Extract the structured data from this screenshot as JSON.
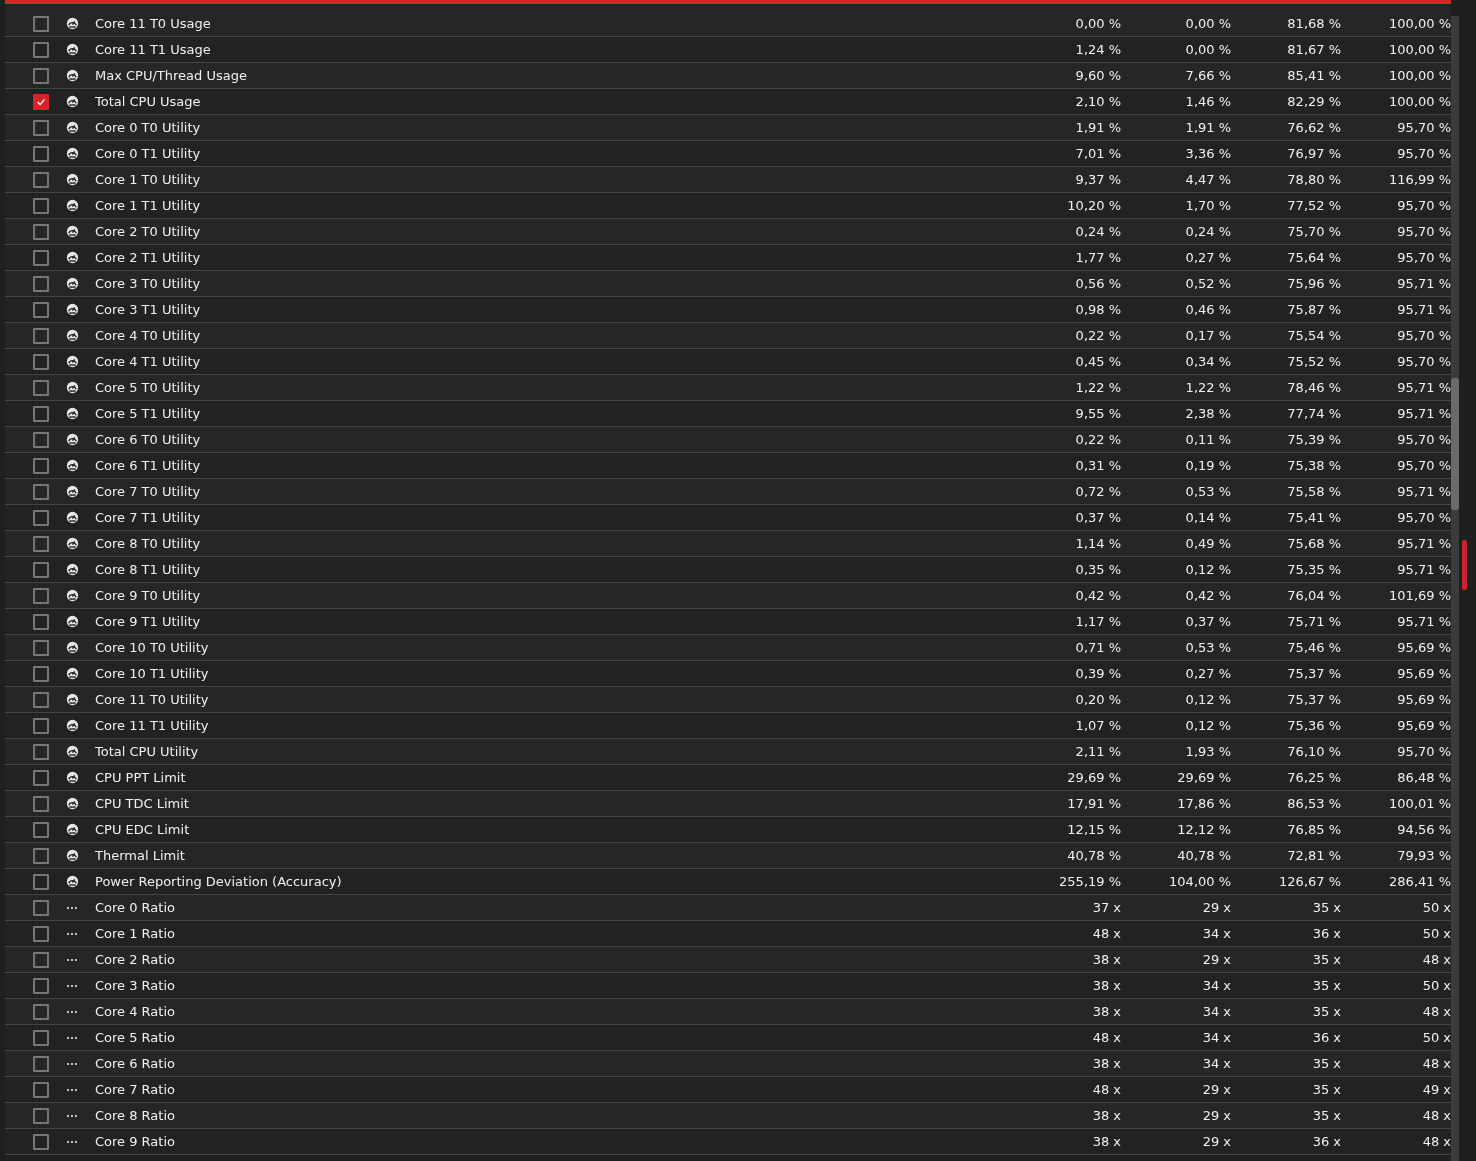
{
  "rows": [
    {
      "kind": "gauge",
      "checked": false,
      "label": "Core 11 T0 Usage",
      "values": [
        "0,00 %",
        "0,00 %",
        "81,68 %",
        "100,00 %"
      ]
    },
    {
      "kind": "gauge",
      "checked": false,
      "label": "Core 11 T1 Usage",
      "values": [
        "1,24 %",
        "0,00 %",
        "81,67 %",
        "100,00 %"
      ]
    },
    {
      "kind": "gauge",
      "checked": false,
      "label": "Max CPU/Thread Usage",
      "values": [
        "9,60 %",
        "7,66 %",
        "85,41 %",
        "100,00 %"
      ]
    },
    {
      "kind": "gauge",
      "checked": true,
      "label": "Total CPU Usage",
      "values": [
        "2,10 %",
        "1,46 %",
        "82,29 %",
        "100,00 %"
      ]
    },
    {
      "kind": "gauge",
      "checked": false,
      "label": "Core 0 T0 Utility",
      "values": [
        "1,91 %",
        "1,91 %",
        "76,62 %",
        "95,70 %"
      ]
    },
    {
      "kind": "gauge",
      "checked": false,
      "label": "Core 0 T1 Utility",
      "values": [
        "7,01 %",
        "3,36 %",
        "76,97 %",
        "95,70 %"
      ]
    },
    {
      "kind": "gauge",
      "checked": false,
      "label": "Core 1 T0 Utility",
      "values": [
        "9,37 %",
        "4,47 %",
        "78,80 %",
        "116,99 %"
      ]
    },
    {
      "kind": "gauge",
      "checked": false,
      "label": "Core 1 T1 Utility",
      "values": [
        "10,20 %",
        "1,70 %",
        "77,52 %",
        "95,70 %"
      ]
    },
    {
      "kind": "gauge",
      "checked": false,
      "label": "Core 2 T0 Utility",
      "values": [
        "0,24 %",
        "0,24 %",
        "75,70 %",
        "95,70 %"
      ]
    },
    {
      "kind": "gauge",
      "checked": false,
      "label": "Core 2 T1 Utility",
      "values": [
        "1,77 %",
        "0,27 %",
        "75,64 %",
        "95,70 %"
      ]
    },
    {
      "kind": "gauge",
      "checked": false,
      "label": "Core 3 T0 Utility",
      "values": [
        "0,56 %",
        "0,52 %",
        "75,96 %",
        "95,71 %"
      ]
    },
    {
      "kind": "gauge",
      "checked": false,
      "label": "Core 3 T1 Utility",
      "values": [
        "0,98 %",
        "0,46 %",
        "75,87 %",
        "95,71 %"
      ]
    },
    {
      "kind": "gauge",
      "checked": false,
      "label": "Core 4 T0 Utility",
      "values": [
        "0,22 %",
        "0,17 %",
        "75,54 %",
        "95,70 %"
      ]
    },
    {
      "kind": "gauge",
      "checked": false,
      "label": "Core 4 T1 Utility",
      "values": [
        "0,45 %",
        "0,34 %",
        "75,52 %",
        "95,70 %"
      ]
    },
    {
      "kind": "gauge",
      "checked": false,
      "label": "Core 5 T0 Utility",
      "values": [
        "1,22 %",
        "1,22 %",
        "78,46 %",
        "95,71 %"
      ]
    },
    {
      "kind": "gauge",
      "checked": false,
      "label": "Core 5 T1 Utility",
      "values": [
        "9,55 %",
        "2,38 %",
        "77,74 %",
        "95,71 %"
      ]
    },
    {
      "kind": "gauge",
      "checked": false,
      "label": "Core 6 T0 Utility",
      "values": [
        "0,22 %",
        "0,11 %",
        "75,39 %",
        "95,70 %"
      ]
    },
    {
      "kind": "gauge",
      "checked": false,
      "label": "Core 6 T1 Utility",
      "values": [
        "0,31 %",
        "0,19 %",
        "75,38 %",
        "95,70 %"
      ]
    },
    {
      "kind": "gauge",
      "checked": false,
      "label": "Core 7 T0 Utility",
      "values": [
        "0,72 %",
        "0,53 %",
        "75,58 %",
        "95,71 %"
      ]
    },
    {
      "kind": "gauge",
      "checked": false,
      "label": "Core 7 T1 Utility",
      "values": [
        "0,37 %",
        "0,14 %",
        "75,41 %",
        "95,70 %"
      ]
    },
    {
      "kind": "gauge",
      "checked": false,
      "label": "Core 8 T0 Utility",
      "values": [
        "1,14 %",
        "0,49 %",
        "75,68 %",
        "95,71 %"
      ]
    },
    {
      "kind": "gauge",
      "checked": false,
      "label": "Core 8 T1 Utility",
      "values": [
        "0,35 %",
        "0,12 %",
        "75,35 %",
        "95,71 %"
      ]
    },
    {
      "kind": "gauge",
      "checked": false,
      "label": "Core 9 T0 Utility",
      "values": [
        "0,42 %",
        "0,42 %",
        "76,04 %",
        "101,69 %"
      ]
    },
    {
      "kind": "gauge",
      "checked": false,
      "label": "Core 9 T1 Utility",
      "values": [
        "1,17 %",
        "0,37 %",
        "75,71 %",
        "95,71 %"
      ]
    },
    {
      "kind": "gauge",
      "checked": false,
      "label": "Core 10 T0 Utility",
      "values": [
        "0,71 %",
        "0,53 %",
        "75,46 %",
        "95,69 %"
      ]
    },
    {
      "kind": "gauge",
      "checked": false,
      "label": "Core 10 T1 Utility",
      "values": [
        "0,39 %",
        "0,27 %",
        "75,37 %",
        "95,69 %"
      ]
    },
    {
      "kind": "gauge",
      "checked": false,
      "label": "Core 11 T0 Utility",
      "values": [
        "0,20 %",
        "0,12 %",
        "75,37 %",
        "95,69 %"
      ]
    },
    {
      "kind": "gauge",
      "checked": false,
      "label": "Core 11 T1 Utility",
      "values": [
        "1,07 %",
        "0,12 %",
        "75,36 %",
        "95,69 %"
      ]
    },
    {
      "kind": "gauge",
      "checked": false,
      "label": "Total CPU Utility",
      "values": [
        "2,11 %",
        "1,93 %",
        "76,10 %",
        "95,70 %"
      ]
    },
    {
      "kind": "gauge",
      "checked": false,
      "label": "CPU PPT Limit",
      "values": [
        "29,69 %",
        "29,69 %",
        "76,25 %",
        "86,48 %"
      ]
    },
    {
      "kind": "gauge",
      "checked": false,
      "label": "CPU TDC Limit",
      "values": [
        "17,91 %",
        "17,86 %",
        "86,53 %",
        "100,01 %"
      ]
    },
    {
      "kind": "gauge",
      "checked": false,
      "label": "CPU EDC Limit",
      "values": [
        "12,15 %",
        "12,12 %",
        "76,85 %",
        "94,56 %"
      ]
    },
    {
      "kind": "gauge",
      "checked": false,
      "label": "Thermal Limit",
      "values": [
        "40,78 %",
        "40,78 %",
        "72,81 %",
        "79,93 %"
      ]
    },
    {
      "kind": "gauge",
      "checked": false,
      "label": "Power Reporting Deviation (Accuracy)",
      "values": [
        "255,19 %",
        "104,00 %",
        "126,67 %",
        "286,41 %"
      ]
    },
    {
      "kind": "dots",
      "checked": false,
      "label": "Core 0 Ratio",
      "values": [
        "37 x",
        "29 x",
        "35 x",
        "50 x"
      ]
    },
    {
      "kind": "dots",
      "checked": false,
      "label": "Core 1 Ratio",
      "values": [
        "48 x",
        "34 x",
        "36 x",
        "50 x"
      ]
    },
    {
      "kind": "dots",
      "checked": false,
      "label": "Core 2 Ratio",
      "values": [
        "38 x",
        "29 x",
        "35 x",
        "48 x"
      ]
    },
    {
      "kind": "dots",
      "checked": false,
      "label": "Core 3 Ratio",
      "values": [
        "38 x",
        "34 x",
        "35 x",
        "50 x"
      ]
    },
    {
      "kind": "dots",
      "checked": false,
      "label": "Core 4 Ratio",
      "values": [
        "38 x",
        "34 x",
        "35 x",
        "48 x"
      ]
    },
    {
      "kind": "dots",
      "checked": false,
      "label": "Core 5 Ratio",
      "values": [
        "48 x",
        "34 x",
        "36 x",
        "50 x"
      ]
    },
    {
      "kind": "dots",
      "checked": false,
      "label": "Core 6 Ratio",
      "values": [
        "38 x",
        "34 x",
        "35 x",
        "48 x"
      ]
    },
    {
      "kind": "dots",
      "checked": false,
      "label": "Core 7 Ratio",
      "values": [
        "48 x",
        "29 x",
        "35 x",
        "49 x"
      ]
    },
    {
      "kind": "dots",
      "checked": false,
      "label": "Core 8 Ratio",
      "values": [
        "38 x",
        "29 x",
        "35 x",
        "48 x"
      ]
    },
    {
      "kind": "dots",
      "checked": false,
      "label": "Core 9 Ratio",
      "values": [
        "38 x",
        "29 x",
        "36 x",
        "48 x"
      ]
    }
  ]
}
